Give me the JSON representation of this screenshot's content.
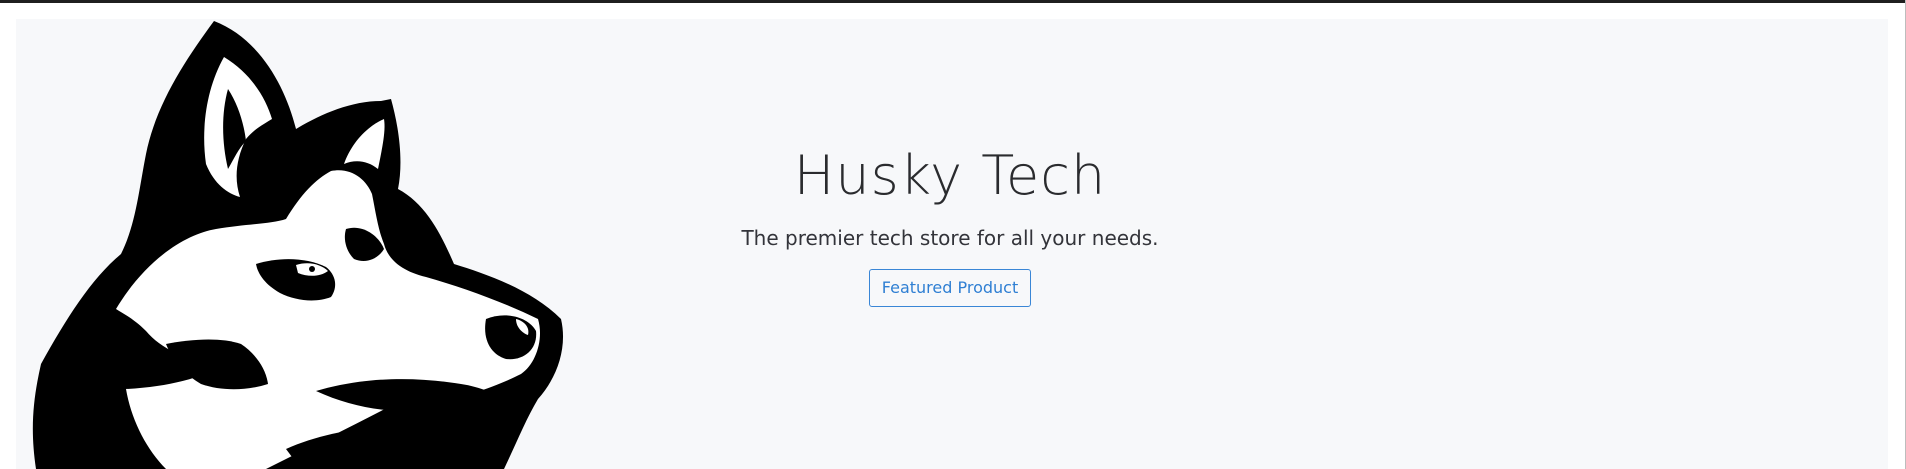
{
  "hero": {
    "title": "Husky Tech",
    "subtitle": "The premier tech store for all your needs.",
    "cta_label": "Featured Product",
    "illustration_icon": "husky-logo-icon"
  },
  "colors": {
    "hero_background": "#f7f8fa",
    "accent": "#2f7fd3",
    "text": "#2a2b2e"
  }
}
